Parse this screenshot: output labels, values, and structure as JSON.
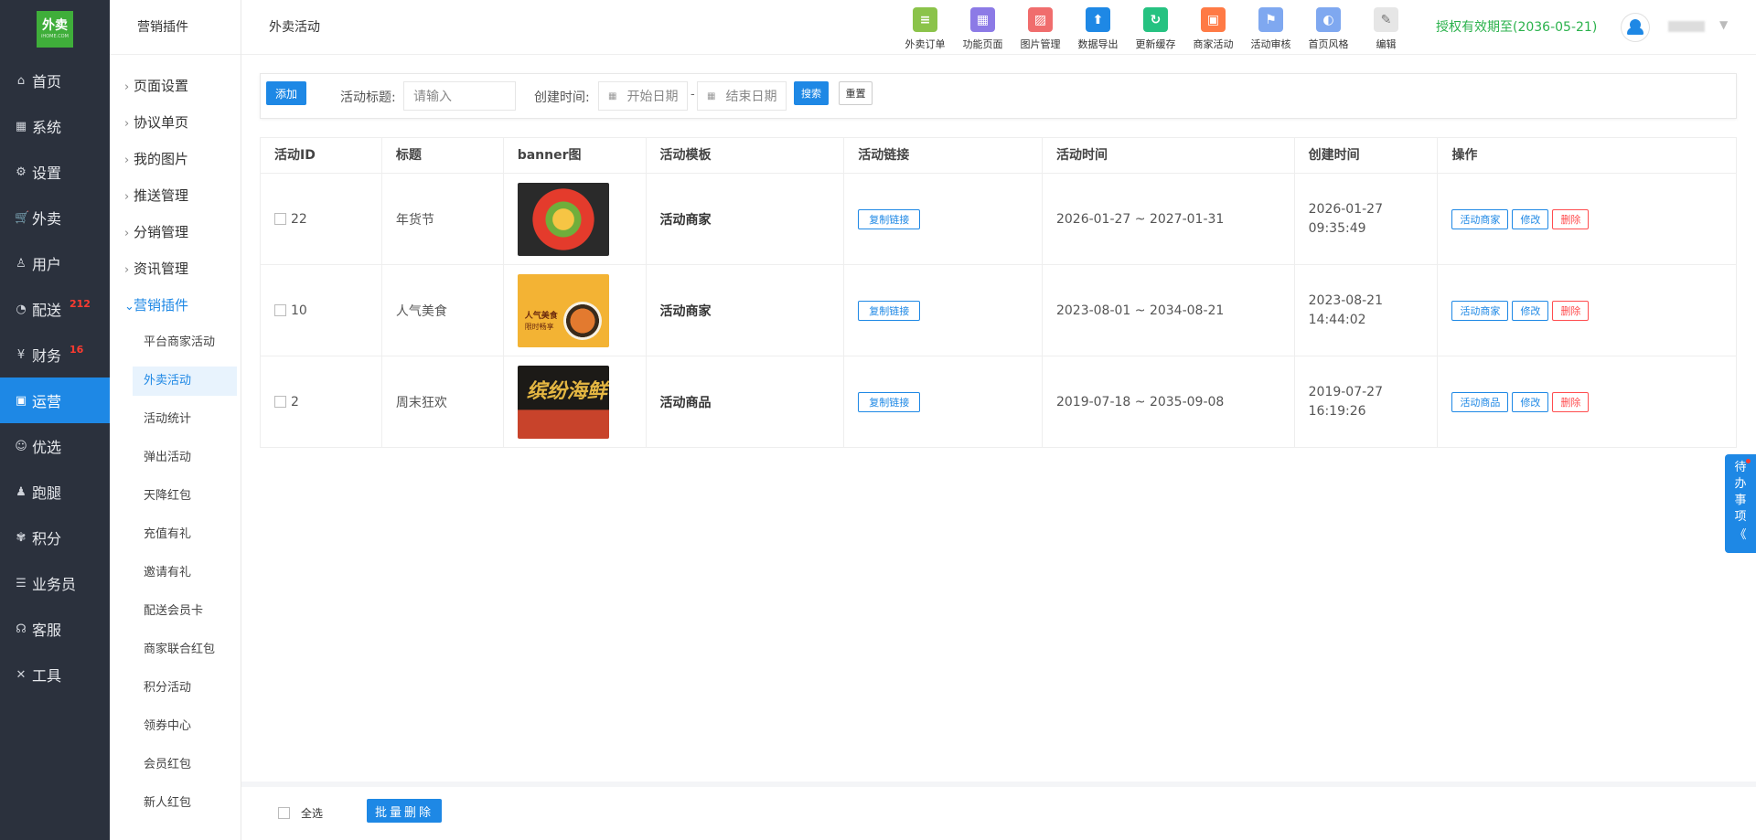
{
  "logo": {
    "text": "外卖",
    "sub": "iHOME.COM"
  },
  "mainNav": [
    {
      "label": "首页",
      "icon": "home-icon",
      "glyph": "⌂",
      "badge": ""
    },
    {
      "label": "系统",
      "icon": "windows-icon",
      "glyph": "▦",
      "badge": ""
    },
    {
      "label": "设置",
      "icon": "gear-icon",
      "glyph": "⚙",
      "badge": ""
    },
    {
      "label": "外卖",
      "icon": "cart-icon",
      "glyph": "🛒",
      "badge": ""
    },
    {
      "label": "用户",
      "icon": "user-icon",
      "glyph": "♙",
      "badge": ""
    },
    {
      "label": "配送",
      "icon": "dashboard-icon",
      "glyph": "◔",
      "badge": "212"
    },
    {
      "label": "财务",
      "icon": "yen-icon",
      "glyph": "¥",
      "badge": "16"
    },
    {
      "label": "运营",
      "icon": "gift-icon",
      "glyph": "▣",
      "badge": ""
    },
    {
      "label": "优选",
      "icon": "smile-icon",
      "glyph": "☺",
      "badge": ""
    },
    {
      "label": "跑腿",
      "icon": "person-icon",
      "glyph": "♟",
      "badge": ""
    },
    {
      "label": "积分",
      "icon": "tag-icon",
      "glyph": "✾",
      "badge": ""
    },
    {
      "label": "业务员",
      "icon": "layers-icon",
      "glyph": "☰",
      "badge": ""
    },
    {
      "label": "客服",
      "icon": "headset-icon",
      "glyph": "☊",
      "badge": ""
    },
    {
      "label": "工具",
      "icon": "tools-icon",
      "glyph": "✕",
      "badge": ""
    }
  ],
  "subnav": {
    "title": "营销插件",
    "groups": [
      "页面设置",
      "协议单页",
      "我的图片",
      "推送管理",
      "分销管理",
      "资讯管理"
    ],
    "openGroup": "营销插件",
    "children": [
      "平台商家活动",
      "外卖活动",
      "活动统计",
      "弹出活动",
      "天降红包",
      "充值有礼",
      "邀请有礼",
      "配送会员卡",
      "商家联合红包",
      "积分活动",
      "领券中心",
      "会员红包",
      "新人红包"
    ]
  },
  "header": {
    "title": "外卖活动",
    "license": "授权有效期至(2036-05-21)",
    "tools": [
      {
        "label": "外卖订单",
        "icon": "order-icon",
        "color": "#8bc34a",
        "glyph": "≡"
      },
      {
        "label": "功能页面",
        "icon": "grid-icon",
        "color": "#8c7ae6",
        "glyph": "▦"
      },
      {
        "label": "图片管理",
        "icon": "image-icon",
        "color": "#f06d6d",
        "glyph": "▨"
      },
      {
        "label": "数据导出",
        "icon": "upload-icon",
        "color": "#1e88e5",
        "glyph": "⬆"
      },
      {
        "label": "更新缓存",
        "icon": "refresh-icon",
        "color": "#26c281",
        "glyph": "↻"
      },
      {
        "label": "商家活动",
        "icon": "gift-icon",
        "color": "#ff7a45",
        "glyph": "▣"
      },
      {
        "label": "活动审核",
        "icon": "flag-icon",
        "color": "#7fa8f0",
        "glyph": "⚑"
      },
      {
        "label": "首页风格",
        "icon": "palette-icon",
        "color": "#7fa8f0",
        "glyph": "◐"
      },
      {
        "label": "编辑",
        "icon": "pencil-icon",
        "color": "#e6e6e6",
        "glyph": "✎"
      }
    ]
  },
  "filter": {
    "add": "添加",
    "titleLabel": "活动标题:",
    "titlePlaceholder": "请输入",
    "timeLabel": "创建时间:",
    "startPlaceholder": "开始日期",
    "endPlaceholder": "结束日期",
    "dash": "-",
    "search": "搜索",
    "reset": "重置"
  },
  "table": {
    "headers": [
      "活动ID",
      "标题",
      "banner图",
      "活动模板",
      "活动链接",
      "活动时间",
      "创建时间",
      "操作"
    ],
    "rows": [
      {
        "id": "22",
        "title": "年货节",
        "banner": "fruit-platter",
        "template": "活动商家",
        "link": "复制链接",
        "period": "2026-01-27 ~ 2027-01-31",
        "createdDate": "2026-01-27",
        "createdTime": "09:35:49",
        "opMain": "活动商家",
        "opEdit": "修改",
        "opDel": "删除"
      },
      {
        "id": "10",
        "title": "人气美食",
        "banner": "popular-food",
        "bannerText1": "人气美食",
        "bannerText2": "限时畅享",
        "template": "活动商家",
        "link": "复制链接",
        "period": "2023-08-01 ~ 2034-08-21",
        "createdDate": "2023-08-21",
        "createdTime": "14:44:02",
        "opMain": "活动商家",
        "opEdit": "修改",
        "opDel": "删除"
      },
      {
        "id": "2",
        "title": "周末狂欢",
        "banner": "seafood",
        "bannerText": "缤纷海鲜",
        "template": "活动商品",
        "link": "复制链接",
        "period": "2019-07-18 ~ 2035-09-08",
        "createdDate": "2019-07-27",
        "createdTime": "16:19:26",
        "opMain": "活动商品",
        "opEdit": "修改",
        "opDel": "删除"
      }
    ]
  },
  "bottom": {
    "selectAll": "全选",
    "batchDelete": "批量删除"
  },
  "todo": {
    "text": [
      "待",
      "办",
      "事",
      "项"
    ],
    "collapse": "《"
  }
}
